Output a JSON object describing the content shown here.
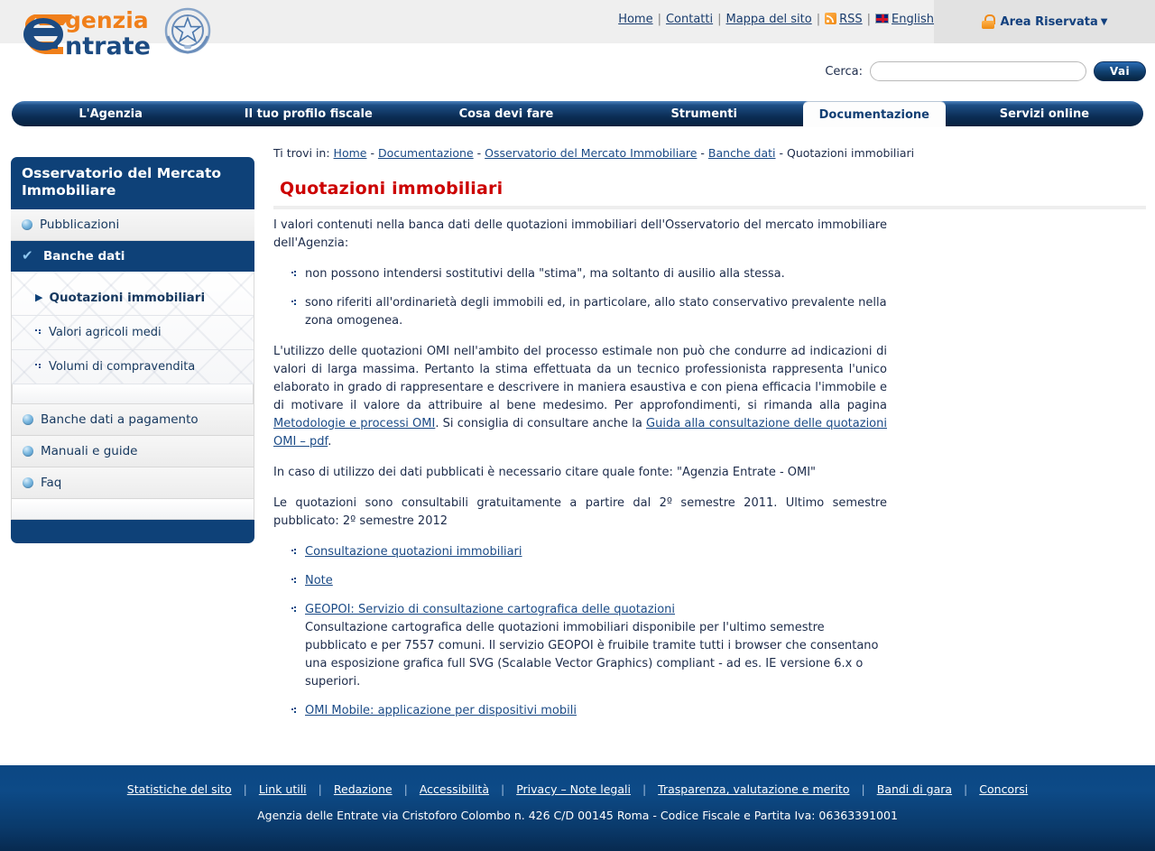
{
  "topbar": {
    "links": [
      {
        "label": "Home",
        "icon": null
      },
      {
        "label": "Contatti",
        "icon": null
      },
      {
        "label": "Mappa del sito",
        "icon": null
      },
      {
        "label": "RSS",
        "icon": "rss-icon"
      },
      {
        "label": "English",
        "icon": "uk-flag-icon"
      }
    ],
    "separator": "|",
    "area_riservata": "Area Riservata",
    "area_riservata_caret": "▼"
  },
  "logo": {
    "word_top": "genzia",
    "word_bottom": "ntrate",
    "orange": "#f07f1a",
    "blue": "#1c4b82"
  },
  "search": {
    "label": "Cerca:",
    "value": "",
    "placeholder": "",
    "button": "Vai"
  },
  "mainnav": {
    "items": [
      {
        "label": "L'Agenzia",
        "active": false
      },
      {
        "label": "Il tuo profilo fiscale",
        "active": false
      },
      {
        "label": "Cosa devi fare",
        "active": false
      },
      {
        "label": "Strumenti",
        "active": false
      },
      {
        "label": "Documentazione",
        "active": true
      },
      {
        "label": "Servizi online",
        "active": false
      }
    ]
  },
  "breadcrumb": {
    "prefix": "Ti trovi in:",
    "items": [
      {
        "label": "Home",
        "link": true
      },
      {
        "label": "Documentazione",
        "link": true
      },
      {
        "label": "Osservatorio del Mercato Immobiliare",
        "link": true
      },
      {
        "label": "Banche dati",
        "link": true
      },
      {
        "label": "Quotazioni immobiliari",
        "link": false
      }
    ],
    "separator": "-"
  },
  "page": {
    "title": "Quotazioni immobiliari"
  },
  "sidebar": {
    "header": "Osservatorio del Mercato Immobiliare",
    "items": [
      {
        "label": "Pubblicazioni",
        "icon": "sphere-icon",
        "active": false
      },
      {
        "label": "Banche dati",
        "icon": "check-icon",
        "active": true
      }
    ],
    "subitems": [
      {
        "label": "Quotazioni immobiliari",
        "icon": "triangle-right-icon",
        "current": true
      },
      {
        "label": "Valori agricoli medi",
        "icon": "dot-bullet-icon",
        "current": false
      },
      {
        "label": "Volumi di compravendita",
        "icon": "dot-bullet-icon",
        "current": false
      }
    ],
    "items2": [
      {
        "label": "Banche dati a pagamento",
        "icon": "sphere-icon"
      },
      {
        "label": "Manuali e guide",
        "icon": "sphere-icon"
      },
      {
        "label": "Faq",
        "icon": "sphere-icon"
      }
    ],
    "triangle_glyph": "▶"
  },
  "content": {
    "intro": "I valori contenuti nella banca dati delle quotazioni immobiliari dell'Osservatorio del mercato immobiliare dell'Agenzia:",
    "intro_bullets": [
      "non possono intendersi sostitutivi della \"stima\", ma soltanto di ausilio alla stessa.",
      "sono riferiti all'ordinarietà degli immobili ed, in particolare, allo stato conservativo prevalente nella zona omogenea."
    ],
    "para2_part1": "L'utilizzo delle quotazioni OMI nell'ambito del processo estimale non può che condurre ad indicazioni di valori di larga massima. Pertanto la stima effettuata da un tecnico professionista rappresenta l'unico elaborato in grado di rappresentare e descrivere in maniera esaustiva e con piena efficacia l'immobile e di motivare il valore da attribuire al bene medesimo. Per approfondimenti, si rimanda alla pagina ",
    "para2_link1": "Metodologie e processi OMI",
    "para2_part2": ". Si consiglia di consultare anche la ",
    "para2_link2": "Guida alla consultazione delle quotazioni OMI – pdf",
    "para2_part3": ".",
    "para3": "In caso di utilizzo dei dati pubblicati è necessario citare quale fonte: \"Agenzia Entrate - OMI\"",
    "para4": "Le quotazioni sono consultabili gratuitamente a partire dal 2º semestre 2011. Ultimo semestre pubblicato: 2º semestre 2012",
    "links": [
      {
        "label": "Consultazione quotazioni immobiliari",
        "desc": ""
      },
      {
        "label": "Note",
        "desc": ""
      },
      {
        "label": "GEOPOI: Servizio di consultazione cartografica delle quotazioni",
        "desc": "Consultazione cartografica delle quotazioni immobiliari disponibile per l'ultimo semestre pubblicato e per 7557 comuni. Il servizio GEOPOI è fruibile tramite tutti i browser che consentano una esposizione grafica full SVG (Scalable Vector Graphics) compliant - ad es. IE versione 6.x o superiori."
      },
      {
        "label": "OMI Mobile: applicazione per dispositivi mobili",
        "desc": ""
      }
    ]
  },
  "footer": {
    "links": [
      "Statistiche del sito",
      "Link utili",
      "Redazione",
      "Accessibilità",
      "Privacy – Note legali",
      "Trasparenza, valutazione e merito",
      "Bandi di gara",
      "Concorsi"
    ],
    "separator": "|",
    "address": "Agenzia delle Entrate via Cristoforo Colombo n. 426 C/D 00145 Roma - Codice Fiscale e Partita Iva: 06363391001"
  },
  "colors": {
    "brand_blue": "#0e4178",
    "brand_orange": "#f07f1a",
    "title_red": "#cc0000",
    "link_blue": "#1a4a86"
  }
}
